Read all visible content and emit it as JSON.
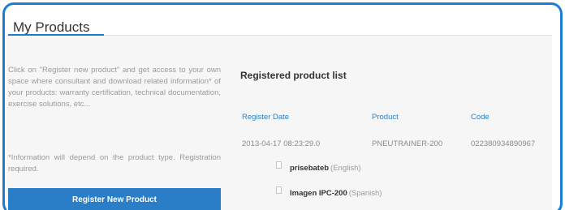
{
  "page": {
    "title": "My Products"
  },
  "sidebar": {
    "intro_text": "Click on \"Register new product\" and get access to your own space where consultant and download related information* of your products: warranty certification, technical documentation, exercise solutions, etc...",
    "note_text": "*Information will depend on the product type. Registration required.",
    "register_button_label": "Register New Product"
  },
  "product_list": {
    "title": "Registered product list",
    "columns": [
      "Register Date",
      "Product",
      "Code"
    ],
    "rows": [
      {
        "register_date": "2013-04-17 08:23:29.0",
        "product": "PNEUTRAINER-200",
        "code": "022380934890967",
        "documents": [
          {
            "name": "prisebateb",
            "language": "(English)"
          },
          {
            "name": "Imagen IPC-200",
            "language": "(Spanish)"
          }
        ]
      }
    ]
  },
  "colors": {
    "frame_border": "#1a7fd4",
    "accent": "#2a7ec7",
    "content_bg": "#f6f6f6"
  }
}
